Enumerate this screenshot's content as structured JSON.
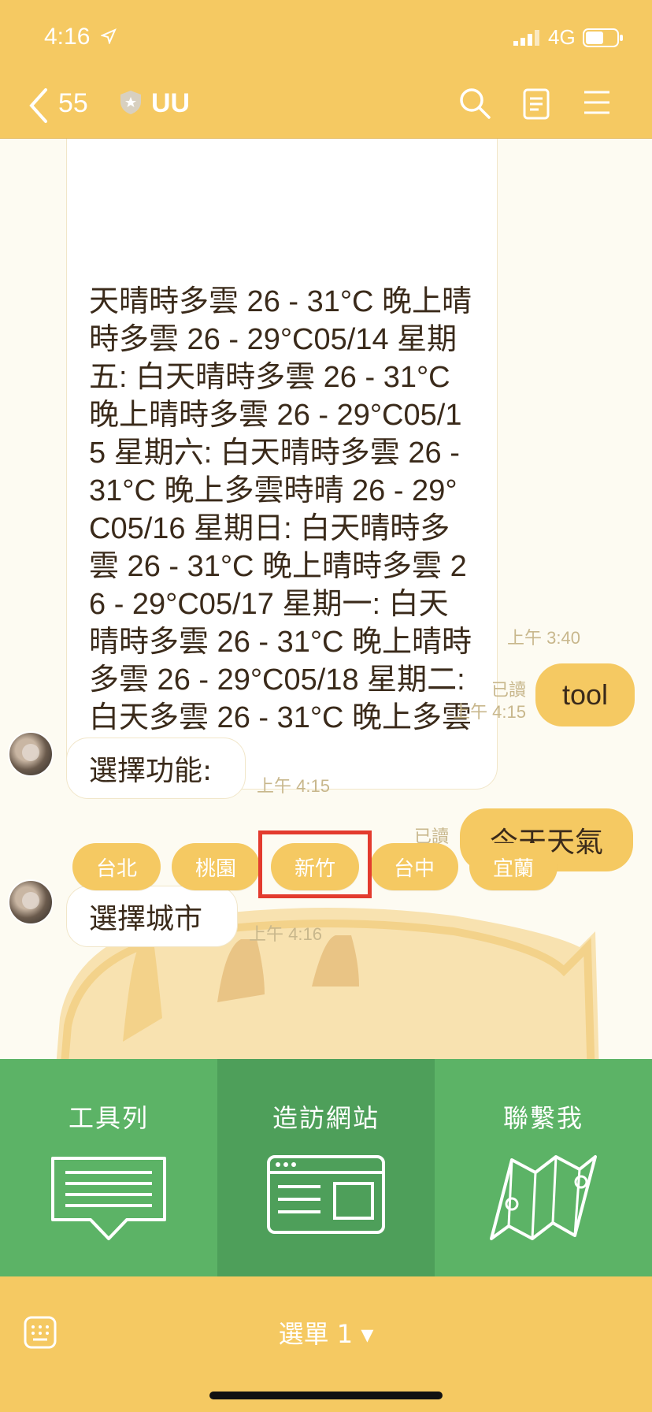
{
  "status": {
    "time": "4:16",
    "network": "4G"
  },
  "nav": {
    "back_count": "55",
    "title": "UU"
  },
  "messages": {
    "long_text": "天晴時多雲 26 - 31°C 晚上晴時多雲 26 - 29°C05/14 星期五: 白天晴時多雲 26 - 31°C 晚上晴時多雲 26 - 29°C05/15 星期六: 白天晴時多雲 26 - 31°C 晚上多雲時晴 26 - 29°C05/16 星期日: 白天晴時多雲 26 - 31°C 晚上晴時多雲 26 - 29°C05/17 星期一: 白天晴時多雲 26 - 31°C 晚上晴時多雲 26 - 29°C05/18 星期二: 白天多雲 26 - 31°C 晚上多雲 24 - 28°C",
    "long_time": "上午 3:40",
    "tool_read": "已讀",
    "tool_time": "上午 4:15",
    "tool_text": "tool",
    "select_func_text": "選擇功能:",
    "select_func_time": "上午 4:15",
    "weather_read": "已讀",
    "weather_time": "上午 4:16",
    "weather_text": "今天天氣",
    "select_city_text": "選擇城市",
    "select_city_time": "上午 4:16"
  },
  "quick_replies": [
    "台北",
    "桃園",
    "新竹",
    "台中",
    "宜蘭"
  ],
  "rich_menu": {
    "toolbar": "工具列",
    "visit_site": "造訪網站",
    "contact": "聯繫我"
  },
  "bottom": {
    "menu_label": "選單 1 ▾"
  },
  "colors": {
    "header": "#f5c962",
    "menu_green": "#5cb366",
    "menu_green_dark": "#4e9f5a",
    "highlight": "#e33b2e"
  }
}
